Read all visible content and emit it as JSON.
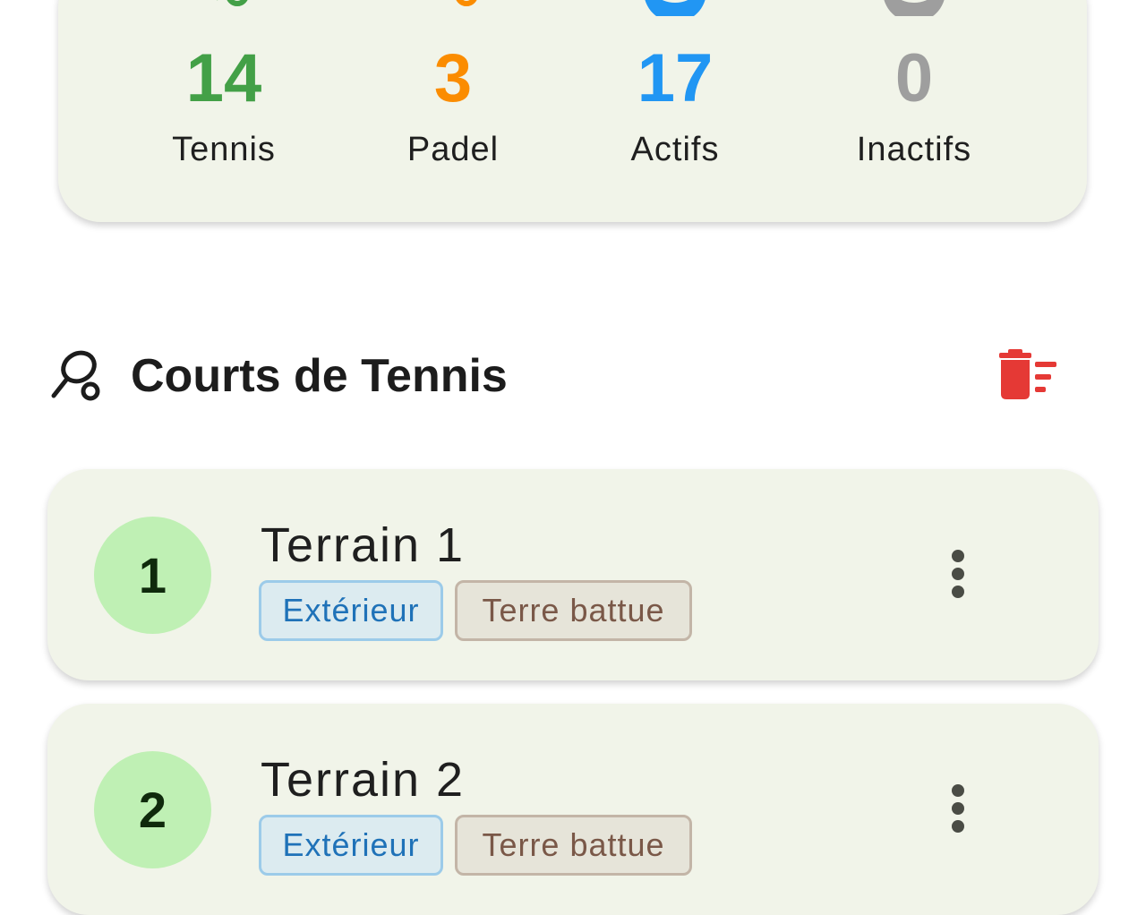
{
  "stats": {
    "tennis": {
      "value": "14",
      "label": "Tennis",
      "color": "#43a047"
    },
    "padel": {
      "value": "3",
      "label": "Padel",
      "color": "#fb8c00"
    },
    "actifs": {
      "value": "17",
      "label": "Actifs",
      "color": "#2196f3"
    },
    "inactifs": {
      "value": "0",
      "label": "Inactifs",
      "color": "#9e9e9e"
    }
  },
  "section": {
    "title": "Courts de Tennis",
    "icon": "tennis-racket-icon",
    "action_icon": "delete-sweep-icon",
    "action_color": "#e53935"
  },
  "courts": [
    {
      "number": "1",
      "name": "Terrain 1",
      "location": "Extérieur",
      "surface": "Terre battue"
    },
    {
      "number": "2",
      "name": "Terrain 2",
      "location": "Extérieur",
      "surface": "Terre battue"
    }
  ]
}
